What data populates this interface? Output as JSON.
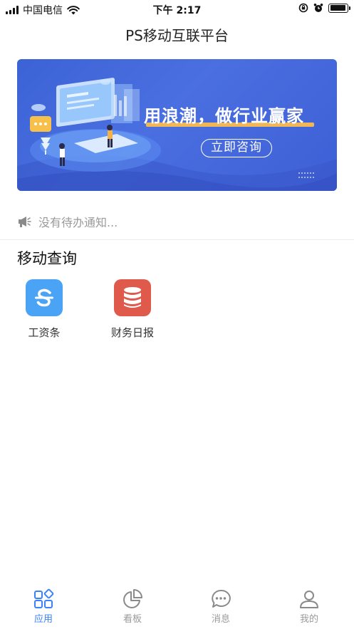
{
  "status_bar": {
    "carrier": "中国电信",
    "time": "下午 2:17",
    "battery_level": 0.95
  },
  "nav": {
    "title": "PS移动互联平台"
  },
  "banner": {
    "slogan": "用浪潮，做行业赢家",
    "button_label": "立即咨询"
  },
  "notice": {
    "icon": "megaphone-icon",
    "text": "没有待办通知..."
  },
  "section": {
    "title": "移动查询",
    "apps": [
      {
        "label": "工资条",
        "icon": "salary-icon",
        "color": "#4aa3f5"
      },
      {
        "label": "财务日报",
        "icon": "database-icon",
        "color": "#e05a4b"
      }
    ]
  },
  "tabbar": {
    "active_color": "#3b82f6",
    "tabs": [
      {
        "label": "应用",
        "icon": "apps-grid-icon",
        "active": true
      },
      {
        "label": "看板",
        "icon": "pie-chart-icon",
        "active": false
      },
      {
        "label": "消息",
        "icon": "chat-bubble-icon",
        "active": false
      },
      {
        "label": "我的",
        "icon": "user-icon",
        "active": false
      }
    ]
  }
}
